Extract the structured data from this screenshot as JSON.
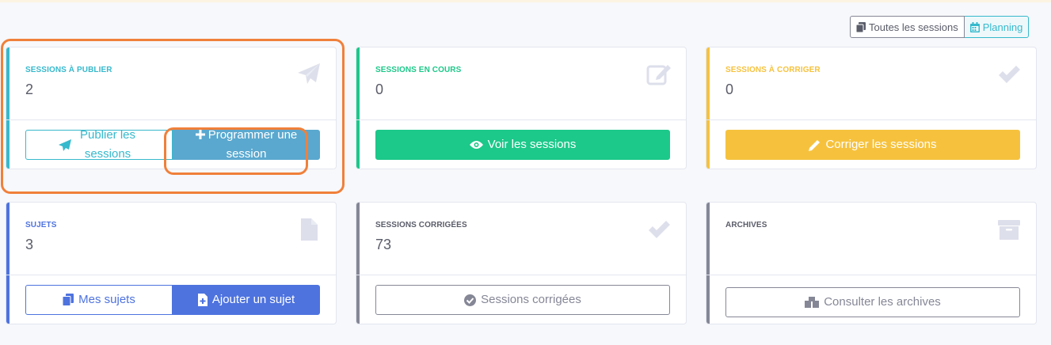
{
  "toolbar": {
    "all_sessions_label": "Toutes les sessions",
    "planning_label": "Planning"
  },
  "cards": {
    "publish": {
      "title": "SESSIONS À PUBLIER",
      "count": "2",
      "icon": "paper-plane-icon",
      "color": "#36b9cc",
      "btn1": "Publier les sessions",
      "btn2": "Programmer une session"
    },
    "in_progress": {
      "title": "SESSIONS EN COURS",
      "count": "0",
      "icon": "edit-icon",
      "color": "#1cc88a",
      "btn1": "Voir les sessions"
    },
    "to_correct": {
      "title": "SESSIONS À CORRIGER",
      "count": "0",
      "icon": "check-icon",
      "color": "#f6c23e",
      "btn1": "Corriger les sessions"
    },
    "subjects": {
      "title": "SUJETS",
      "count": "3",
      "icon": "file-icon",
      "color": "#4e73df",
      "btn1": "Mes sujets",
      "btn2": "Ajouter un sujet"
    },
    "corrected": {
      "title": "SESSIONS CORRIGÉES",
      "count": "73",
      "icon": "check-icon",
      "color": "#858796",
      "btn1": "Sessions corrigées"
    },
    "archives": {
      "title": "ARCHIVES",
      "icon": "archive-icon",
      "color": "#858796",
      "btn1": "Consulter les archives"
    }
  }
}
